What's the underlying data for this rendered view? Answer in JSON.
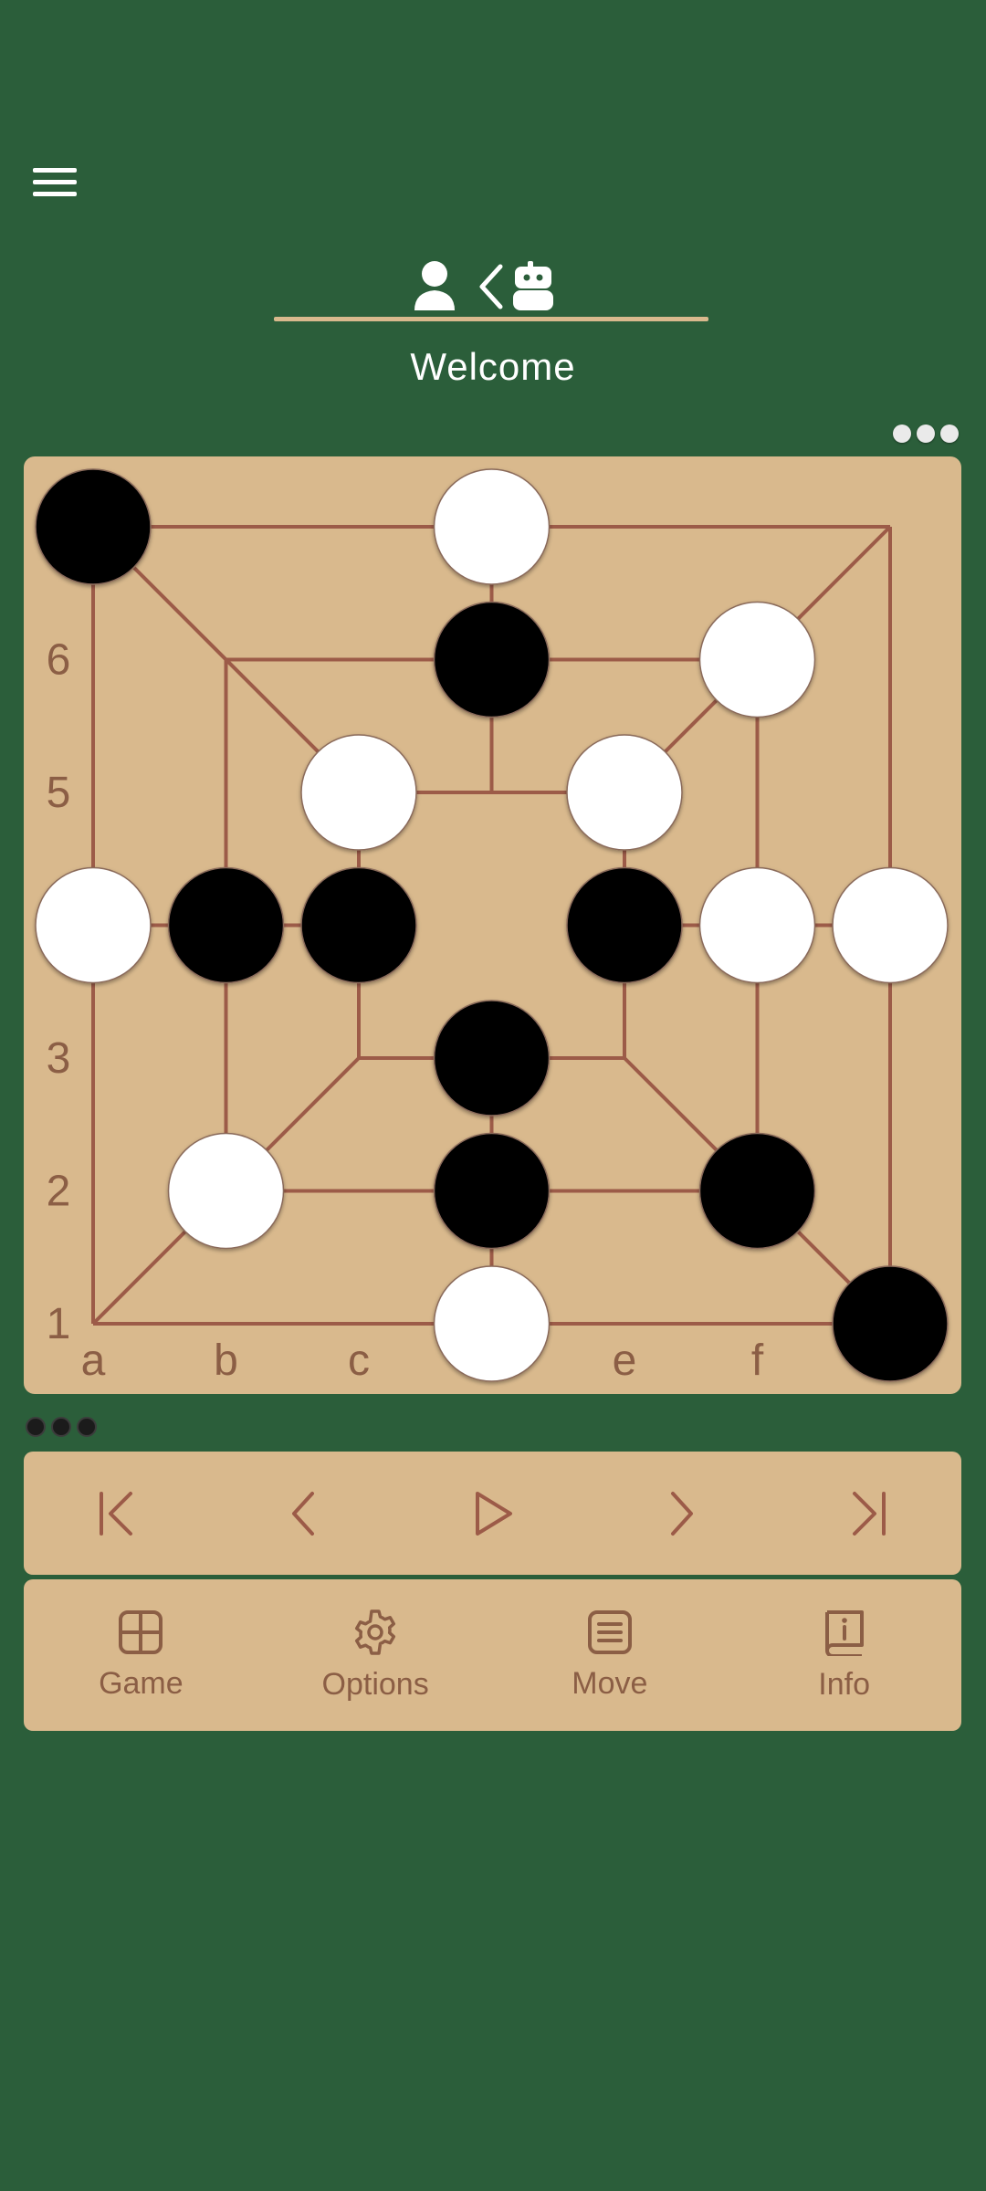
{
  "app": {
    "title": "Welcome",
    "player_left_icon": "person-icon",
    "turn_indicator_icon": "chevron-left-icon",
    "player_right_icon": "robot-icon"
  },
  "colors": {
    "background": "#2b5e3a",
    "board": "#d9b98d",
    "lines": "#9c5b48",
    "label": "#8b5e45",
    "white_piece": "#ffffff",
    "black_piece": "#000000"
  },
  "board": {
    "row_labels": [
      "1",
      "2",
      "3",
      "5",
      "6"
    ],
    "col_labels": [
      "a",
      "b",
      "c",
      "e",
      "f"
    ],
    "white_pieces": [
      "d7",
      "f6",
      "c5",
      "e5",
      "a4",
      "f4",
      "g4",
      "b2",
      "d1"
    ],
    "black_pieces": [
      "a7",
      "d6",
      "b4",
      "c4",
      "e4",
      "d3",
      "d2",
      "f2",
      "g1"
    ]
  },
  "pieces_in_hand": {
    "white": 3,
    "black": 3
  },
  "controls": [
    {
      "name": "first-move-button",
      "icon": "skip-to-start-icon"
    },
    {
      "name": "previous-move-button",
      "icon": "chevron-left-icon"
    },
    {
      "name": "play-button",
      "icon": "play-icon"
    },
    {
      "name": "next-move-button",
      "icon": "chevron-right-icon"
    },
    {
      "name": "last-move-button",
      "icon": "skip-to-end-icon"
    }
  ],
  "tabs": [
    {
      "label": "Game",
      "icon": "board-grid-icon"
    },
    {
      "label": "Options",
      "icon": "gear-icon"
    },
    {
      "label": "Move",
      "icon": "list-icon"
    },
    {
      "label": "Info",
      "icon": "info-book-icon"
    }
  ]
}
